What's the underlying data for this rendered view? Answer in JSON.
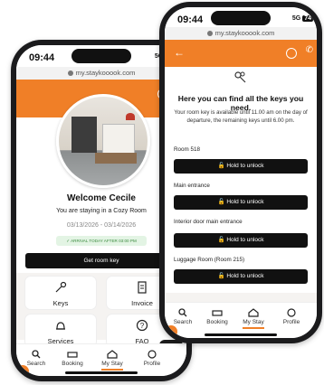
{
  "phone1": {
    "time": "09:44",
    "network": "5G",
    "battery": "74",
    "url": "my.staykooook.com",
    "welcome": "Welcome Cecile",
    "room_text": "You are staying in a Cozy Room",
    "dates": "03/13/2026 - 03/14/2026",
    "arrival_badge": "ARRIVAL TODAY AFTER 03:00 PM",
    "get_key": "Get room key",
    "tiles": {
      "keys": "Keys",
      "invoice": "Invoice",
      "services": "Services",
      "faq": "FAQ"
    }
  },
  "phone2": {
    "time": "09:44",
    "network": "5G",
    "battery": "74",
    "url": "my.staykooook.com",
    "heading": "Here you can find all the keys you need.",
    "subtext": "Your room key is available until 11.00 am on the day of departure, the remaining keys until 6.00 pm.",
    "keys": [
      {
        "label": "Room 518",
        "button": "Hold to unlock"
      },
      {
        "label": "Main entrance",
        "button": "Hold to unlock"
      },
      {
        "label": "Interior door main entrance",
        "button": "Hold to unlock"
      },
      {
        "label": "Luggage Room (Room 215)",
        "button": "Hold to unlock"
      }
    ]
  },
  "tabbar": {
    "search": "Search",
    "booking": "Booking",
    "mystay": "My Stay",
    "profile": "Profile"
  },
  "colors": {
    "accent": "#f07f27",
    "dark": "#111111",
    "badge_bg": "#e3f4e4",
    "badge_text": "#3b8a3f"
  }
}
